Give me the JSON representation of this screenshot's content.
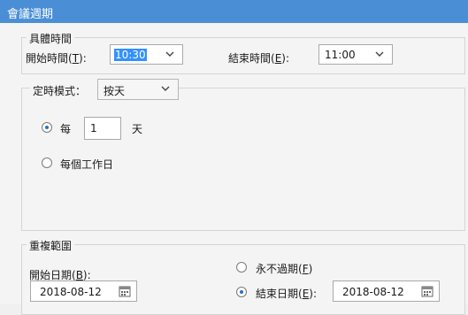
{
  "window": {
    "title": "會議週期"
  },
  "time_section": {
    "legend": "具體時間",
    "start_label": "開始時間(",
    "start_key": "T",
    "start_suffix": "):",
    "start_value": "10:30",
    "end_label": "結束時間(",
    "end_key": "E",
    "end_suffix": "):",
    "end_value": "11:00"
  },
  "schedule_section": {
    "mode_label": "定時模式：",
    "mode_value": "按天",
    "every_label": "每",
    "every_value": "1",
    "every_unit": "天",
    "workday_label": "每個工作日",
    "every_selected": true,
    "workday_selected": false
  },
  "repeat_section": {
    "legend": "重複範圍",
    "start_date_label": "開始日期(",
    "start_date_key": "B",
    "start_date_suffix": "):",
    "start_date_value": "2018-08-12",
    "never_label": "永不過期(",
    "never_key": "F",
    "never_suffix": ")",
    "end_date_label": "結束日期(",
    "end_date_key": "E",
    "end_date_suffix": "):",
    "end_date_value": "2018-08-12",
    "never_selected": false,
    "end_date_selected": true
  }
}
